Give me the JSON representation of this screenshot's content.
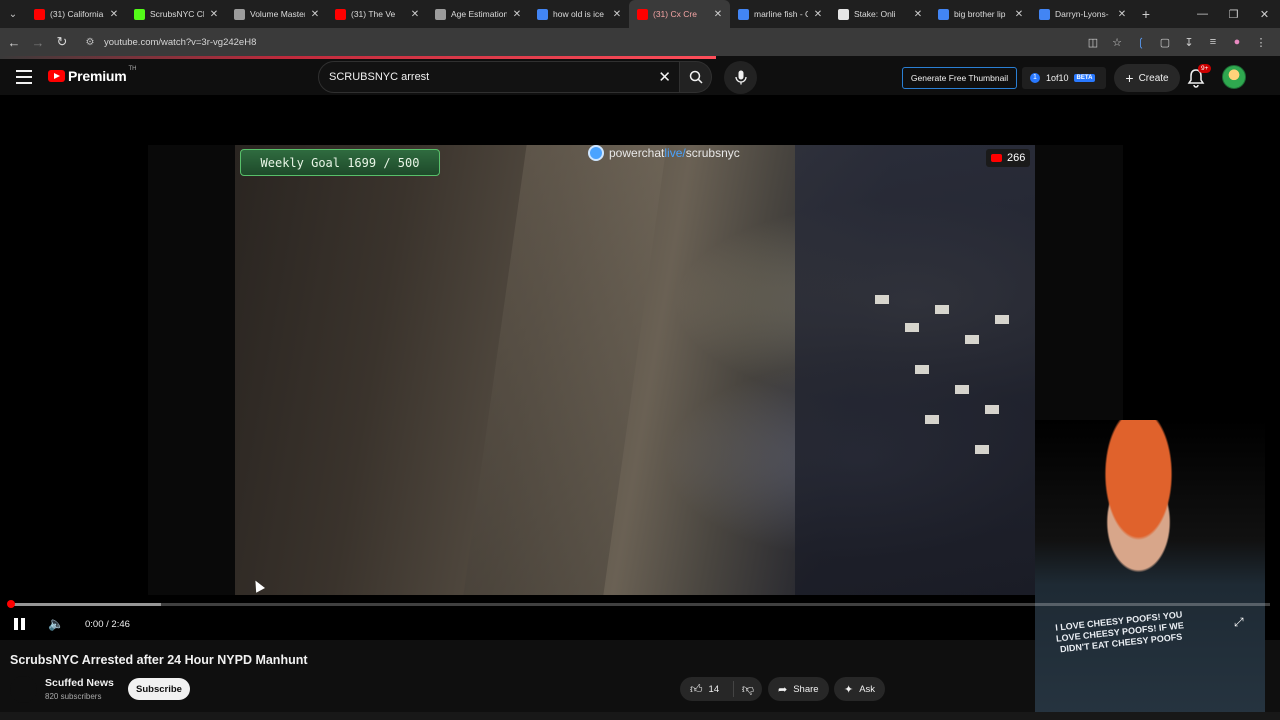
{
  "browser": {
    "tabs": [
      {
        "label": "(31) California",
        "favicon_color": "#ff0000",
        "active": false,
        "closable": true
      },
      {
        "label": "ScrubsNYC Clip",
        "favicon_color": "#53fc18",
        "active": false,
        "closable": true
      },
      {
        "label": "Volume Master",
        "favicon_color": "#9c9c9c",
        "active": false,
        "closable": true
      },
      {
        "label": "(31) The Ve",
        "favicon_color": "#ff0000",
        "active": false,
        "closable": true
      },
      {
        "label": "Age Estimation",
        "favicon_color": "#9c9c9c",
        "active": false,
        "closable": true
      },
      {
        "label": "how old is ice",
        "favicon_color": "#4285f4",
        "active": false,
        "closable": true
      },
      {
        "label": "(31) Cx Cre",
        "favicon_color": "#ff0000",
        "active": true,
        "closable": true
      },
      {
        "label": "marline fish - C",
        "favicon_color": "#4285f4",
        "active": false,
        "closable": true
      },
      {
        "label": "Stake: Onli",
        "favicon_color": "#e6e6e6",
        "active": false,
        "closable": true
      },
      {
        "label": "big brother lip",
        "favicon_color": "#4285f4",
        "active": false,
        "closable": true
      },
      {
        "label": "Darryn-Lyons-",
        "favicon_color": "#4285f4",
        "active": false,
        "closable": true
      }
    ],
    "url": "youtube.com/watch?v=3r-vg242eH8"
  },
  "header": {
    "logo_text": "Premium",
    "logo_sup": "TH",
    "search_value": "SCRUBSNYC arrest",
    "generate_thumbnail": "Generate Free Thumbnail",
    "oneof10_label": "1of10",
    "oneof10_icon": "1",
    "beta_label": "BETA",
    "create_label": "Create",
    "notifications_badge": "9+"
  },
  "video": {
    "goal_text": "Weekly Goal 1699 / 500",
    "powerchat_prefix": "powerchat",
    "powerchat_live": "live/",
    "powerchat_user": "scrubsnyc",
    "viewer_count": "266",
    "shirt_text": "I LOVE CHEESY POOFS! YOU LOVE CHEESY POOFS! IF WE DIDN'T EAT CHEESY POOFS",
    "time_display": "0:00 / 2:46",
    "progress_fraction": 0.0,
    "buffered_fraction": 0.12
  },
  "details": {
    "title": "ScrubsNYC Arrested after 24 Hour NYPD Manhunt",
    "channel_name": "Scuffed News",
    "subscribers": "820 subscribers",
    "subscribe_label": "Subscribe",
    "like_count": "14",
    "share_label": "Share",
    "ask_label": "Ask"
  }
}
